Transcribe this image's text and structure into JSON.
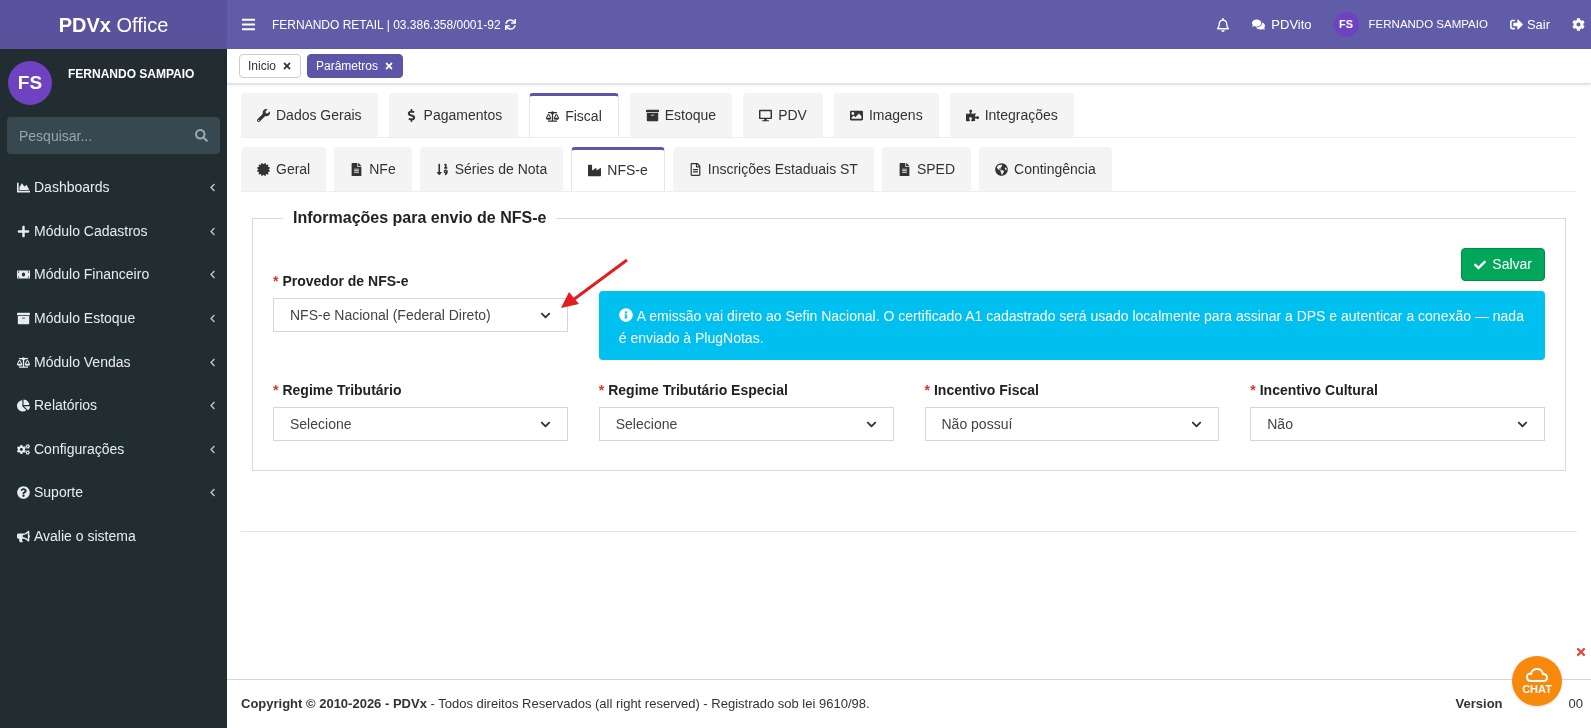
{
  "brand": "**PDVx** Office",
  "sidebar": {
    "user": {
      "initials": "FS",
      "name": "FERNANDO SAMPAIO"
    },
    "search": {
      "placeholder": "Pesquisar..."
    },
    "items": [
      {
        "label": "Dashboards",
        "kind": "menu"
      },
      {
        "label": "Módulo Cadastros",
        "kind": "menu"
      },
      {
        "label": "Módulo Financeiro",
        "kind": "menu"
      },
      {
        "label": "Módulo Estoque",
        "kind": "menu"
      },
      {
        "label": "Módulo Vendas",
        "kind": "menu"
      },
      {
        "label": "Relatórios",
        "kind": "menu"
      },
      {
        "label": "Configurações",
        "kind": "menu"
      },
      {
        "label": "Suporte",
        "kind": "menu"
      },
      {
        "label": "Avalie o sistema",
        "kind": "link"
      }
    ]
  },
  "topbar": {
    "company": "FERNANDO RETAIL | 03.386.358/0001-92",
    "assistant": "PDVito",
    "user": {
      "initials": "FS",
      "name": "FERNANDO SAMPAIO"
    },
    "logout": "Sair"
  },
  "open_pages": [
    {
      "label": "Inicio",
      "selected": false
    },
    {
      "label": "Parâmetros",
      "selected": true
    }
  ],
  "tabs": [
    {
      "label": "Dados Gerais",
      "selected": false
    },
    {
      "label": "Pagamentos",
      "selected": false
    },
    {
      "label": "Fiscal",
      "selected": true
    },
    {
      "label": "Estoque",
      "selected": false
    },
    {
      "label": "PDV",
      "selected": false
    },
    {
      "label": "Imagens",
      "selected": false
    },
    {
      "label": "Integrações",
      "selected": false
    }
  ],
  "subtabs": [
    {
      "label": "Geral",
      "selected": false
    },
    {
      "label": "NFe",
      "selected": false
    },
    {
      "label": "Séries de Nota",
      "selected": false
    },
    {
      "label": "NFS-e",
      "selected": true
    },
    {
      "label": "Inscrições Estaduais ST",
      "selected": false
    },
    {
      "label": "SPED",
      "selected": false
    },
    {
      "label": "Contingência",
      "selected": false
    }
  ],
  "form": {
    "legend": "Informações para envio de NFS-e",
    "save_button": "Salvar",
    "provider": {
      "label": "Provedor de NFS-e",
      "marker": "*",
      "value": "NFS-e Nacional (Federal Direto)"
    },
    "info": "A emissão vai direto ao Sefin Nacional. O certificado A1 cadastrado será usado localmente para assinar a DPS e autenticar a conexão — nada é enviado à PlugNotas.",
    "fields": [
      {
        "label": "Regime Tributário",
        "marker": "*",
        "value": "Selecione"
      },
      {
        "label": "Regime Tributário Especial",
        "marker": "*",
        "value": "Selecione"
      },
      {
        "label": "Incentivo Fiscal",
        "marker": "*",
        "value": "Não possuí"
      },
      {
        "label": "Incentivo Cultural",
        "marker": "*",
        "value": "Não"
      }
    ]
  },
  "footer": {
    "copyright": "**Copyright © 2010-2026 - PDVx** - Todos direitos Reservados (all right reserved) - Registrado sob lei 9610/98.",
    "version_label": "Version",
    "version_value": "00"
  },
  "chat": {
    "label": "CHAT"
  }
}
